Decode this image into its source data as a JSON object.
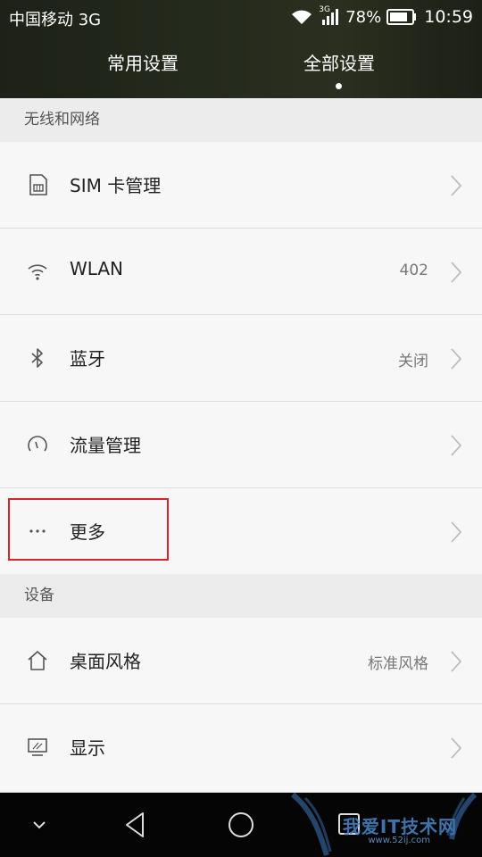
{
  "status_bar": {
    "carrier": "中国移动 3G",
    "network_badge": "3G",
    "battery": "78%",
    "time": "10:59"
  },
  "tabs": [
    {
      "label": "常用设置",
      "active": false
    },
    {
      "label": "全部设置",
      "active": true
    }
  ],
  "sections": {
    "wireless": {
      "title": "无线和网络",
      "items": [
        {
          "label": "SIM 卡管理",
          "value": "",
          "icon": "sim-card-icon"
        },
        {
          "label": "WLAN",
          "value": "402",
          "icon": "wifi-icon"
        },
        {
          "label": "蓝牙",
          "value": "关闭",
          "icon": "bluetooth-icon"
        },
        {
          "label": "流量管理",
          "value": "",
          "icon": "data-usage-icon"
        },
        {
          "label": "更多",
          "value": "",
          "icon": "more-icon"
        }
      ]
    },
    "device": {
      "title": "设备",
      "items": [
        {
          "label": "桌面风格",
          "value": "标准风格",
          "icon": "home-icon"
        },
        {
          "label": "显示",
          "value": "",
          "icon": "display-icon"
        }
      ]
    }
  },
  "watermark": {
    "text": "我爱IT技术网",
    "url": "www.52ij.com"
  },
  "colors": {
    "highlight": "#d8232a",
    "header_bg": "#242a1c"
  }
}
